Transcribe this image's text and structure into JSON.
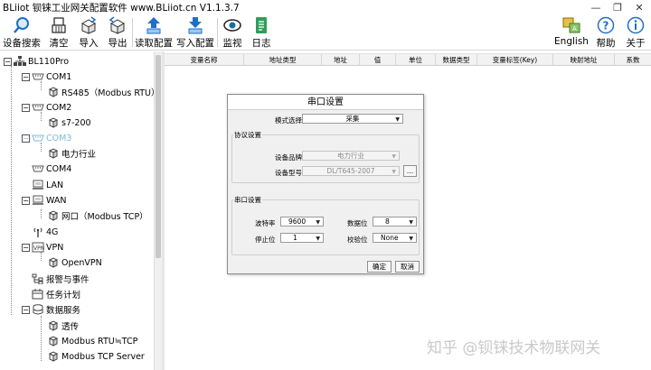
{
  "window": {
    "logo_text": "BLiiot",
    "title": "钡铼工业网关配置软件 www.BLiiot.cn V1.1.3.7",
    "controls": [
      "—",
      "❐",
      "✕"
    ]
  },
  "toolbar": {
    "left": [
      {
        "label": "设备搜索",
        "icon": "search-icon"
      },
      {
        "label": "清空",
        "icon": "broom-icon"
      },
      {
        "label": "导入",
        "icon": "import-box-icon"
      },
      {
        "label": "导出",
        "icon": "export-box-icon"
      },
      {
        "label": "读取配置",
        "icon": "upload-arrow-icon"
      },
      {
        "label": "写入配置",
        "icon": "download-arrow-icon"
      },
      {
        "label": "监视",
        "icon": "eye-icon"
      },
      {
        "label": "日志",
        "icon": "log-document-icon"
      }
    ],
    "right": [
      {
        "label": "English",
        "icon": "language-icon"
      },
      {
        "label": "帮助",
        "icon": "help-icon"
      },
      {
        "label": "关于",
        "icon": "info-icon"
      }
    ]
  },
  "tree": {
    "root": "BL110Pro",
    "items": [
      {
        "label": "COM1",
        "icon": "serial-port-icon"
      },
      {
        "label": "RS485（Modbus RTU）",
        "icon": "cube-icon"
      },
      {
        "label": "COM2",
        "icon": "serial-port-icon"
      },
      {
        "label": "s7-200",
        "icon": "cube-icon"
      },
      {
        "label": "COM3",
        "icon": "serial-port-icon"
      },
      {
        "label": "电力行业",
        "icon": "cube-icon"
      },
      {
        "label": "COM4",
        "icon": "serial-port-icon"
      },
      {
        "label": "LAN",
        "icon": "network-icon"
      },
      {
        "label": "WAN",
        "icon": "network-icon"
      },
      {
        "label": "网口（Modbus TCP）",
        "icon": "cube-icon"
      },
      {
        "label": "4G",
        "icon": "antenna-icon"
      },
      {
        "label": "VPN",
        "icon": "vpn-icon"
      },
      {
        "label": "OpenVPN",
        "icon": "cube-icon"
      },
      {
        "label": "报警与事件",
        "icon": "alarm-tree-icon"
      },
      {
        "label": "任务计划",
        "icon": "task-calendar-icon"
      },
      {
        "label": "数据服务",
        "icon": "database-icon"
      },
      {
        "label": "透传",
        "icon": "cube-icon"
      },
      {
        "label": "Modbus RTU≒TCP",
        "icon": "cube-icon"
      },
      {
        "label": "Modbus TCP Server",
        "icon": "cube-icon"
      }
    ]
  },
  "table": {
    "columns": [
      "变量名称",
      "地址类型",
      "地址",
      "值",
      "单位",
      "数据类型",
      "变量标签(Key)",
      "映射地址",
      "系数"
    ]
  },
  "dialog": {
    "title": "串口设置",
    "mode_label": "模式选择",
    "mode_value": "采集",
    "protocol_group": "协议设置",
    "brand_label": "设备品牌",
    "brand_value": "电力行业",
    "model_label": "设备型号",
    "model_value": "DL/T645-2007",
    "browse_label": "...",
    "serial_group": "串口设置",
    "baud_label": "波特率",
    "baud_value": "9600",
    "databits_label": "数据位",
    "databits_value": "8",
    "stopbits_label": "停止位",
    "stopbits_value": "1",
    "parity_label": "校验位",
    "parity_value": "None",
    "ok_label": "确定",
    "cancel_label": "取消"
  },
  "watermark": "知乎 @钡铼技术物联网关",
  "colors": {
    "accent": "#1f6fc4",
    "disabled_node": "#7fb8d8",
    "dialog_bg": "#f0f0f0"
  }
}
